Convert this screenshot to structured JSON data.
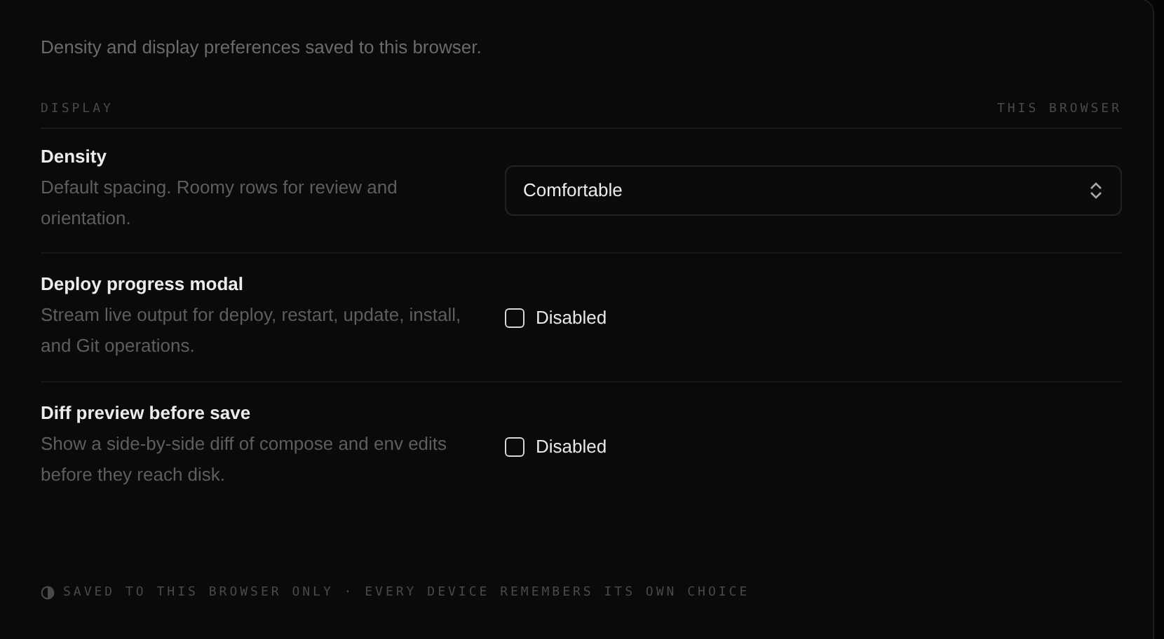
{
  "intro": "Density and display preferences saved to this browser.",
  "section": {
    "title": "DISPLAY",
    "scope": "THIS BROWSER"
  },
  "settings": [
    {
      "kind": "select",
      "title": "Density",
      "description": "Default spacing. Roomy rows for review and orientation.",
      "value": "Comfortable"
    },
    {
      "kind": "checkbox",
      "title": "Deploy progress modal",
      "description": "Stream live output for deploy, restart, update, install, and Git operations.",
      "checked": false,
      "label": "Disabled"
    },
    {
      "kind": "checkbox",
      "title": "Diff preview before save",
      "description": "Show a side-by-side diff of compose and env edits before they reach disk.",
      "checked": false,
      "label": "Disabled"
    }
  ],
  "footer": "SAVED TO THIS BROWSER ONLY · EVERY DEVICE REMEMBERS ITS OWN CHOICE"
}
